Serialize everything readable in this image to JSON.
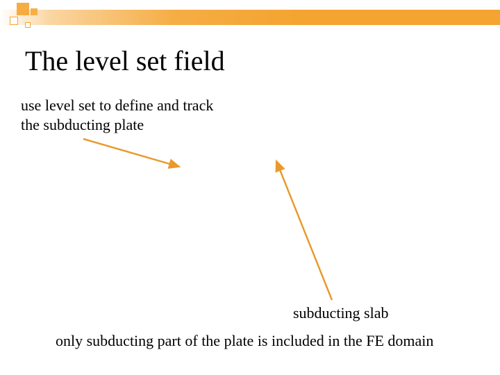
{
  "title": "The level set field",
  "description_line1": "use level set to define and track",
  "description_line2": "the subducting plate",
  "slab_label": "subducting slab",
  "bottom_note": "only subducting part of the plate is included in the FE domain",
  "colors": {
    "accent": "#f4a430"
  }
}
